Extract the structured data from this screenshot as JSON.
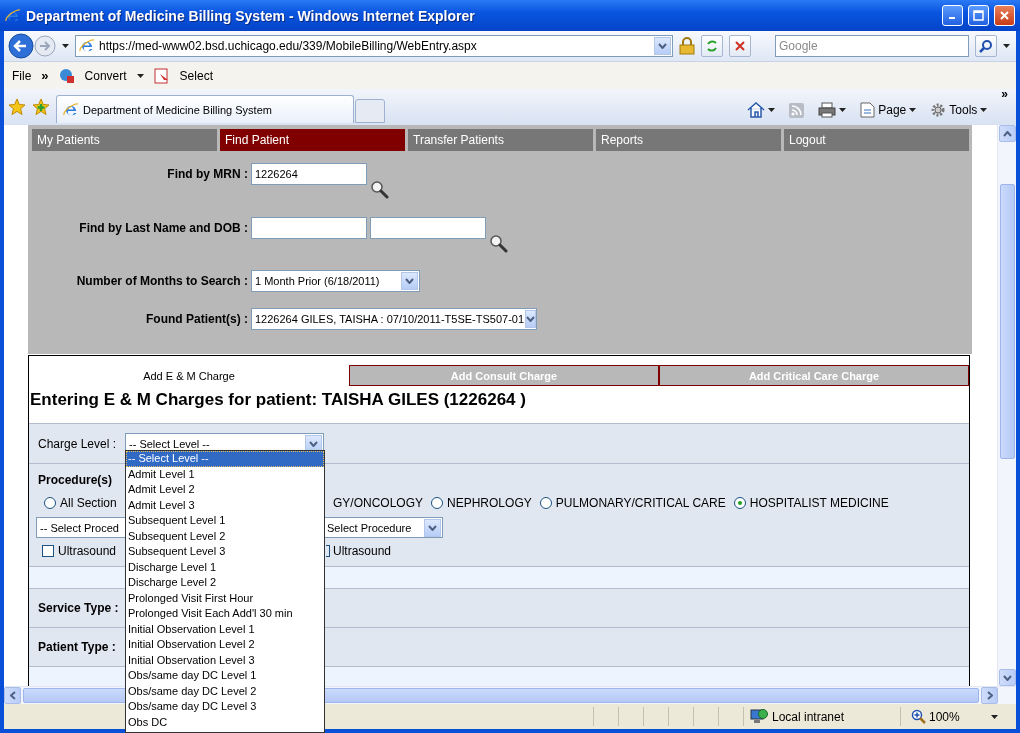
{
  "window": {
    "title": "Department of Medicine Billing System - Windows Internet Explorer"
  },
  "address_bar": {
    "url": "https://med-www02.bsd.uchicago.edu/339/MobileBilling/WebEntry.aspx"
  },
  "search": {
    "placeholder": "Google"
  },
  "menu": [
    {
      "label": "File",
      "kind": "menu"
    },
    {
      "label": "»",
      "kind": "chevron"
    },
    {
      "label": "Convert",
      "kind": "convert"
    },
    {
      "label": "Select",
      "kind": "select"
    }
  ],
  "browser_tabs": [
    {
      "label": "Department of Medicine Billing System",
      "selected": true
    }
  ],
  "command_bar": [
    {
      "label": "Page",
      "kind": "page"
    },
    {
      "label": "Tools",
      "kind": "tools"
    },
    {
      "label": "»",
      "kind": "chevron"
    }
  ],
  "nav": [
    {
      "label": "My Patients",
      "selected": false
    },
    {
      "label": "Find Patient",
      "selected": true
    },
    {
      "label": "Transfer Patients",
      "selected": false
    },
    {
      "label": "Reports",
      "selected": false
    },
    {
      "label": "Logout",
      "selected": false
    }
  ],
  "search_form": {
    "mrn_label": "Find by MRN :",
    "mrn": "1226264",
    "name_label": "Find by Last Name and DOB :",
    "months_label": "Number of Months to Search :",
    "months": "1 Month Prior (6/18/2011)",
    "found_label": "Found Patient(s) :",
    "found": "1226264 GILES, TAISHA : 07/10/2011-T5SE-TS507-01"
  },
  "charge_tabs": [
    {
      "label": "Add E & M Charge",
      "selected": true
    },
    {
      "label": "Add Consult Charge",
      "selected": false
    },
    {
      "label": "Add Critical Care Charge",
      "selected": false
    }
  ],
  "heading": "Entering E & M Charges for patient: TAISHA GILES (1226264 )",
  "charge_level": {
    "label": "Charge Level :",
    "value": "-- Select Level --",
    "expanded": true
  },
  "charge_level_options": [
    {
      "label": "-- Select Level --",
      "selected": true
    },
    {
      "label": "Admit Level 1",
      "selected": false
    },
    {
      "label": "Admit Level 2",
      "selected": false
    },
    {
      "label": "Admit Level 3",
      "selected": false
    },
    {
      "label": "Subsequent Level 1",
      "selected": false
    },
    {
      "label": "Subsequent Level 2",
      "selected": false
    },
    {
      "label": "Subsequent Level 3",
      "selected": false
    },
    {
      "label": "Discharge Level 1",
      "selected": false
    },
    {
      "label": "Discharge Level 2",
      "selected": false
    },
    {
      "label": "Prolonged Visit First Hour",
      "selected": false
    },
    {
      "label": "Prolonged Visit Each Add'l 30 min",
      "selected": false
    },
    {
      "label": "Initial Observation Level 1",
      "selected": false
    },
    {
      "label": "Initial Observation Level 2",
      "selected": false
    },
    {
      "label": "Initial Observation Level 3",
      "selected": false
    },
    {
      "label": "Obs/same day DC Level 1",
      "selected": false
    },
    {
      "label": "Obs/same day DC Level 2",
      "selected": false
    },
    {
      "label": "Obs/same day DC Level 3",
      "selected": false
    },
    {
      "label": "Obs DC",
      "selected": false
    }
  ],
  "procedures": {
    "label": "Procedure(s)",
    "sections": [
      {
        "label": "All Section",
        "kind": "radio",
        "selected": false
      },
      {
        "label": "GY/ONCOLOGY",
        "kind": "cut"
      },
      {
        "label": "NEPHROLOGY",
        "kind": "radio",
        "selected": false
      },
      {
        "label": "PULMONARY/CRITICAL CARE",
        "kind": "radio",
        "selected": false
      },
      {
        "label": "HOSPITALIST MEDICINE",
        "kind": "radio",
        "selected": true
      }
    ],
    "selects": [
      "-- Select Proced",
      "Select Procedure"
    ],
    "checks": [
      {
        "label": "Ultrasound",
        "checked": false
      },
      {
        "label": "Ultrasound",
        "checked": false
      }
    ]
  },
  "service_type": {
    "label": "Service Type :"
  },
  "patient_type": {
    "label": "Patient Type :"
  },
  "status_bar": {
    "zone": "Local intranet",
    "zoom": "100%"
  }
}
